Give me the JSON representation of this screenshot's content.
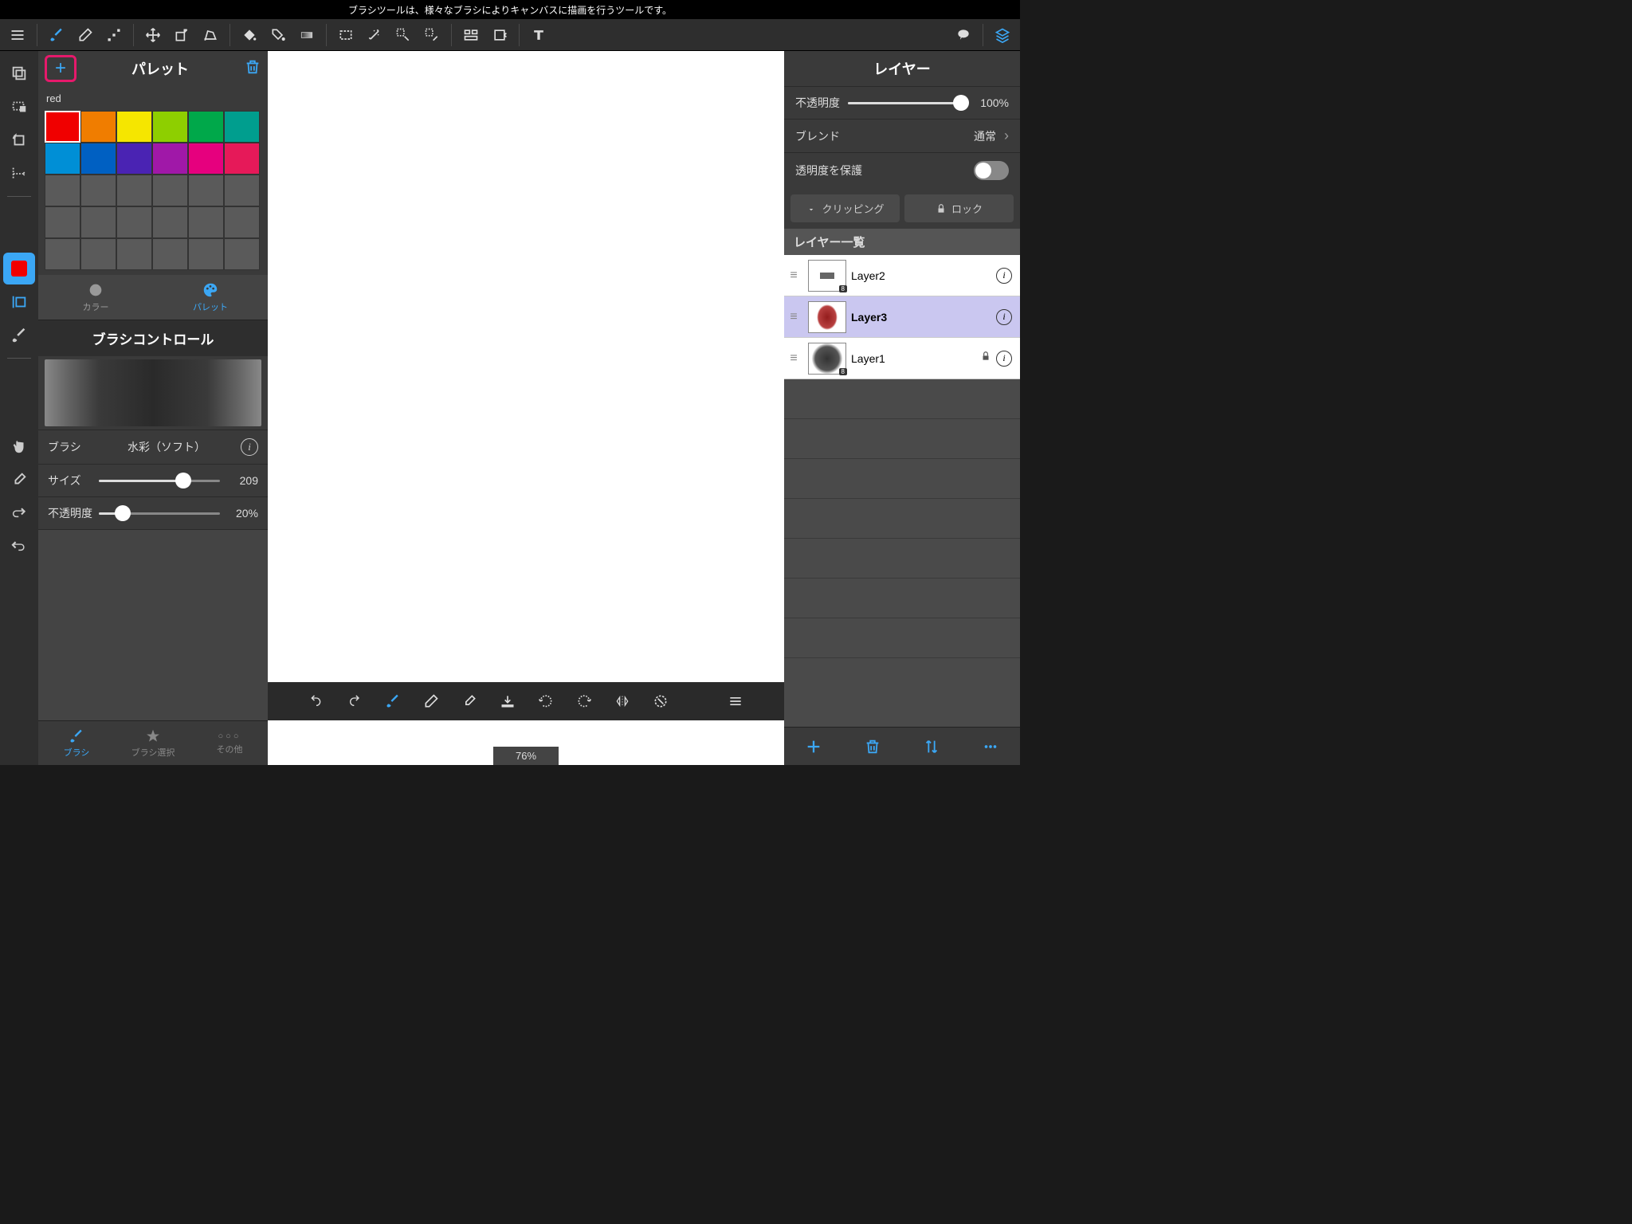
{
  "tooltip": "ブラシツールは、様々なブラシによりキャンバスに描画を行うツールです。",
  "palette": {
    "title": "パレット",
    "colorName": "red",
    "colors_row1": [
      "#f00000",
      "#f07d00",
      "#f5e600",
      "#8ecf00",
      "#00a84a",
      "#009e8e"
    ],
    "colors_row2": [
      "#008fd6",
      "#0060c2",
      "#4a23b3",
      "#a018a8",
      "#e6007e",
      "#e61959"
    ],
    "tabs": {
      "color": "カラー",
      "palette": "パレット"
    }
  },
  "brushControl": {
    "title": "ブラシコントロール",
    "brushLabel": "ブラシ",
    "brushName": "水彩（ソフト）",
    "sizeLabel": "サイズ",
    "sizeValue": "209",
    "sizePercent": 70,
    "opacityLabel": "不透明度",
    "opacityValue": "20%",
    "opacityPercent": 20
  },
  "bottomTabs": {
    "brush": "ブラシ",
    "select": "ブラシ選択",
    "other": "その他"
  },
  "zoom": "76%",
  "layerPanel": {
    "title": "レイヤー",
    "opacityLabel": "不透明度",
    "opacityValue": "100%",
    "opacityPercent": 100,
    "blendLabel": "ブレンド",
    "blendValue": "通常",
    "protectLabel": "透明度を保護",
    "clipping": "クリッピング",
    "lock": "ロック",
    "listHeader": "レイヤー一覧",
    "layers": [
      {
        "name": "Layer2",
        "badge": "8"
      },
      {
        "name": "Layer3"
      },
      {
        "name": "Layer1",
        "badge": "8"
      }
    ]
  }
}
